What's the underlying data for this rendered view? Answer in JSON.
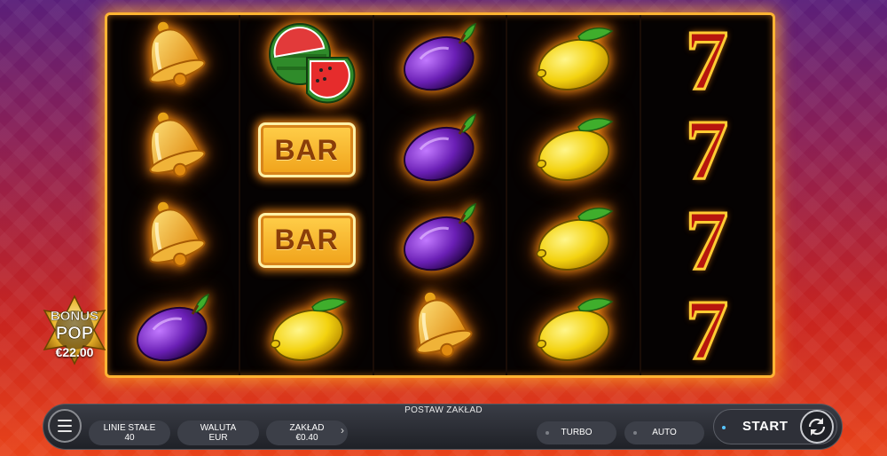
{
  "game": {
    "reels": [
      [
        "bell",
        "bell",
        "bell",
        "plum"
      ],
      [
        "watermelon",
        "bar",
        "bar",
        "lemon"
      ],
      [
        "plum",
        "plum",
        "plum",
        "bell"
      ],
      [
        "lemon",
        "lemon",
        "lemon",
        "lemon"
      ],
      [
        "seven",
        "seven",
        "seven",
        "seven"
      ]
    ],
    "bar_text": "BAR",
    "seven_text": "7"
  },
  "bonus": {
    "line1": "BONUS",
    "line2": "POP",
    "amount": "€22.00"
  },
  "controls": {
    "bet_title": "POSTAW ZAKŁAD",
    "lines": {
      "label": "LINIE STAŁE",
      "value": "40"
    },
    "currency": {
      "label": "WALUTA",
      "value": "EUR"
    },
    "bet": {
      "label": "ZAKŁAD",
      "value": "€0.40"
    },
    "arrow": "›",
    "turbo_label": "TURBO",
    "auto_label": "AUTO",
    "start_label": "START"
  },
  "colors": {
    "frame_glow": "#ffb433",
    "accent_blue": "#58c5ff",
    "bar_text": "#8a3e08",
    "seven_red": "#b7160d"
  },
  "icons": [
    "menu-icon",
    "autoplay-cycle-icon",
    "bell-icon",
    "plum-icon",
    "lemon-icon",
    "watermelon-icon",
    "bar-icon",
    "seven-icon"
  ]
}
